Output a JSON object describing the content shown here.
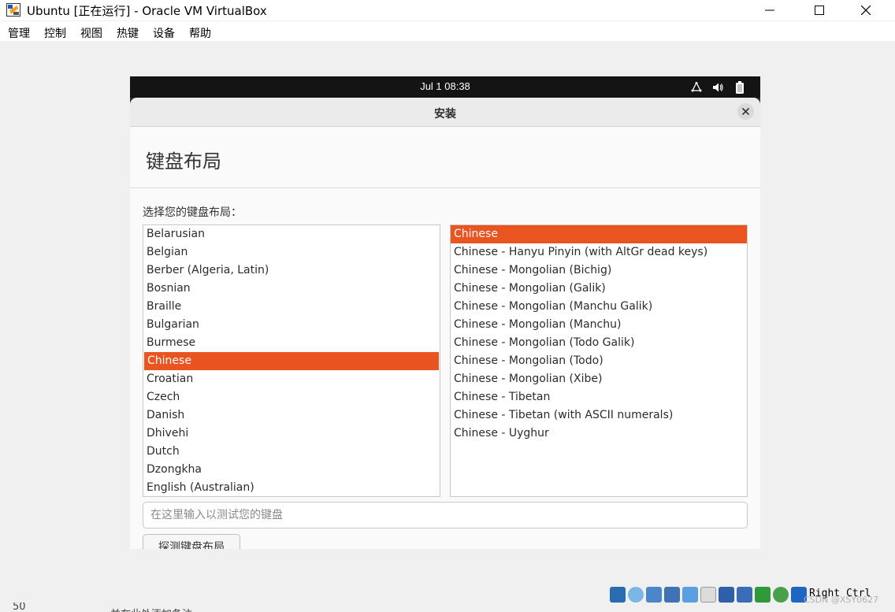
{
  "window": {
    "title": "Ubuntu [正在运行] - Oracle VM VirtualBox",
    "controls": [
      "minimize",
      "maximize",
      "close"
    ]
  },
  "menubar": {
    "items": [
      "管理",
      "控制",
      "视图",
      "热键",
      "设备",
      "帮助"
    ]
  },
  "guest": {
    "topbar": {
      "clock": "Jul 1  08:38"
    },
    "dialog": {
      "title": "安装",
      "heading": "键盘布局",
      "prompt": "选择您的键盘布局：",
      "languages": [
        "Belarusian",
        "Belgian",
        "Berber (Algeria, Latin)",
        "Bosnian",
        "Braille",
        "Bulgarian",
        "Burmese",
        "Chinese",
        "Croatian",
        "Czech",
        "Danish",
        "Dhivehi",
        "Dutch",
        "Dzongkha",
        "English (Australian)"
      ],
      "selected_language": "Chinese",
      "variants": [
        "Chinese",
        "Chinese - Hanyu Pinyin (with AltGr dead keys)",
        "Chinese - Mongolian (Bichig)",
        "Chinese - Mongolian (Galik)",
        "Chinese - Mongolian (Manchu Galik)",
        "Chinese - Mongolian (Manchu)",
        "Chinese - Mongolian (Todo Galik)",
        "Chinese - Mongolian (Todo)",
        "Chinese - Mongolian (Xibe)",
        "Chinese - Tibetan",
        "Chinese - Tibetan (with ASCII numerals)",
        "Chinese - Uyghur"
      ],
      "selected_variant": "Chinese",
      "test_input_placeholder": "在这里输入以测试您的键盘",
      "detect_button": "探测键盘布局"
    }
  },
  "statusbar": {
    "host_key": "Right Ctrl",
    "watermark": "CSDN @XSY0627"
  },
  "background_strip": {
    "number": "50",
    "text": "并在此处添加备注"
  },
  "colors": {
    "accent": "#e95420",
    "topbar": "#141414",
    "dialog_bg": "#fafafa"
  }
}
